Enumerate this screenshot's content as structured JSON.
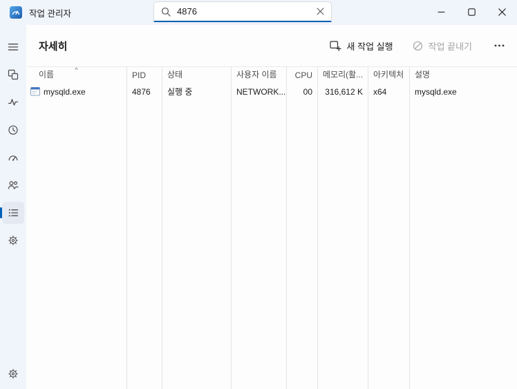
{
  "titlebar": {
    "title": "작업 관리자",
    "search": {
      "value": "4876"
    }
  },
  "header": {
    "page_title": "자세히",
    "run_new_task_label": "새 작업 실행",
    "end_task_label": "작업 끝내기"
  },
  "sidebar": {
    "items": [
      {
        "icon": "hamburger-menu-icon",
        "selected": false
      },
      {
        "icon": "processes-icon",
        "selected": false
      },
      {
        "icon": "performance-icon",
        "selected": false
      },
      {
        "icon": "app-history-icon",
        "selected": false
      },
      {
        "icon": "startup-apps-icon",
        "selected": false
      },
      {
        "icon": "users-icon",
        "selected": false
      },
      {
        "icon": "details-icon",
        "selected": true
      },
      {
        "icon": "services-icon",
        "selected": false
      }
    ],
    "bottom_item": {
      "icon": "settings-gear-icon"
    }
  },
  "table": {
    "sort_caret": "^",
    "columns": [
      {
        "label": "이름"
      },
      {
        "label": "PID"
      },
      {
        "label": "상태"
      },
      {
        "label": "사용자 이름"
      },
      {
        "label": "CPU"
      },
      {
        "label": "메모리(활..."
      },
      {
        "label": "아키텍처"
      },
      {
        "label": "설명"
      }
    ],
    "rows": [
      {
        "name": "mysqld.exe",
        "pid": "4876",
        "status": "실행 중",
        "user": "NETWORK...",
        "cpu": "00",
        "memory": "316,612 K",
        "architecture": "x64",
        "description": "mysqld.exe"
      }
    ]
  },
  "colors": {
    "accent": "#005fb8",
    "titlebar_bg": "#f0f4fb",
    "disabled_text": "#a3a3a3"
  }
}
